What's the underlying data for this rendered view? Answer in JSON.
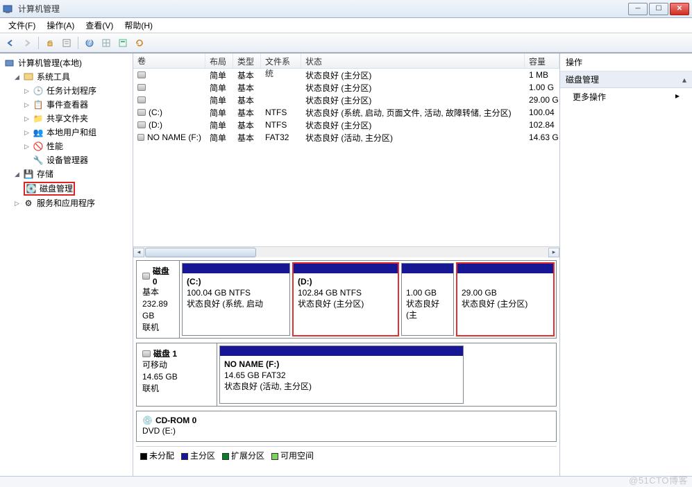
{
  "window": {
    "title": "计算机管理"
  },
  "menus": {
    "file": "文件(F)",
    "action": "操作(A)",
    "view": "查看(V)",
    "help": "帮助(H)"
  },
  "tree": {
    "root": "计算机管理(本地)",
    "system_tools": "系统工具",
    "task_scheduler": "任务计划程序",
    "event_viewer": "事件查看器",
    "shared_folders": "共享文件夹",
    "local_users": "本地用户和组",
    "performance": "性能",
    "device_manager": "设备管理器",
    "storage": "存储",
    "disk_management": "磁盘管理",
    "services_apps": "服务和应用程序"
  },
  "columns": {
    "volume": "卷",
    "layout": "布局",
    "type": "类型",
    "fs": "文件系统",
    "status": "状态",
    "capacity": "容量"
  },
  "volumes": [
    {
      "name": "",
      "layout": "简单",
      "type": "基本",
      "fs": "",
      "status": "状态良好 (主分区)",
      "capacity": "1 MB"
    },
    {
      "name": "",
      "layout": "简单",
      "type": "基本",
      "fs": "",
      "status": "状态良好 (主分区)",
      "capacity": "1.00 G"
    },
    {
      "name": "",
      "layout": "简单",
      "type": "基本",
      "fs": "",
      "status": "状态良好 (主分区)",
      "capacity": "29.00 G"
    },
    {
      "name": "(C:)",
      "layout": "简单",
      "type": "基本",
      "fs": "NTFS",
      "status": "状态良好 (系统, 启动, 页面文件, 活动, 故障转储, 主分区)",
      "capacity": "100.04"
    },
    {
      "name": "(D:)",
      "layout": "简单",
      "type": "基本",
      "fs": "NTFS",
      "status": "状态良好 (主分区)",
      "capacity": "102.84"
    },
    {
      "name": "NO NAME (F:)",
      "layout": "简单",
      "type": "基本",
      "fs": "FAT32",
      "status": "状态良好 (活动, 主分区)",
      "capacity": "14.63 G"
    }
  ],
  "disks": {
    "d0": {
      "title": "磁盘 0",
      "type": "基本",
      "size": "232.89 GB",
      "state": "联机"
    },
    "d0_parts": {
      "p0": {
        "name": "(C:)",
        "l2": "100.04 GB NTFS",
        "l3": "状态良好 (系统, 启动"
      },
      "p1": {
        "name": "(D:)",
        "l2": "102.84 GB NTFS",
        "l3": "状态良好 (主分区)"
      },
      "p2": {
        "name": "",
        "l2": "1.00 GB",
        "l3": "状态良好 (主"
      },
      "p3": {
        "name": "",
        "l2": "29.00 GB",
        "l3": "状态良好 (主分区)"
      }
    },
    "d1": {
      "title": "磁盘 1",
      "type": "可移动",
      "size": "14.65 GB",
      "state": "联机"
    },
    "d1_parts": {
      "p0": {
        "name": "NO NAME  (F:)",
        "l2": "14.65 GB FAT32",
        "l3": "状态良好 (活动, 主分区)"
      }
    },
    "cd": {
      "title": "CD-ROM 0",
      "sub": "DVD (E:)"
    }
  },
  "legend": {
    "unalloc": "未分配",
    "primary": "主分区",
    "extended": "扩展分区",
    "free": "可用空间"
  },
  "actions": {
    "header": "操作",
    "group": "磁盘管理",
    "more": "更多操作"
  },
  "watermark": "@51CTO博客"
}
